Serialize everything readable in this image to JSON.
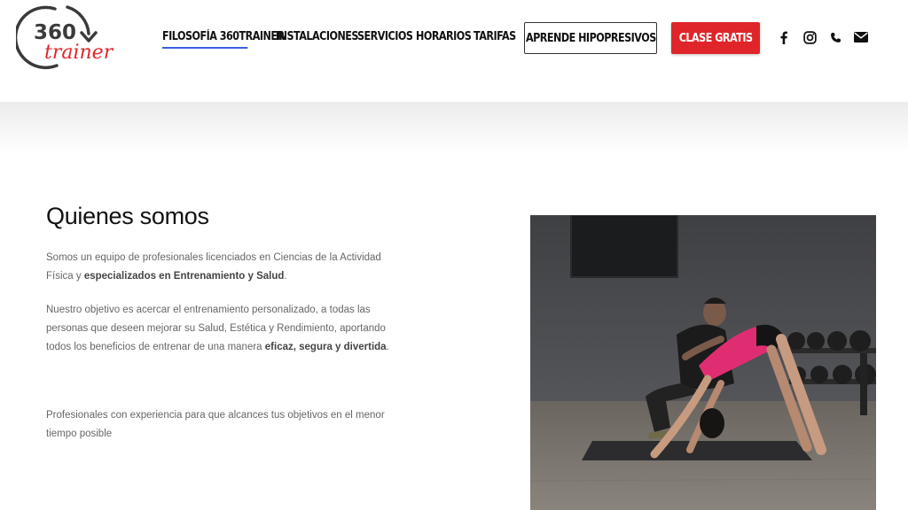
{
  "logo": {
    "number": "360",
    "word": "trainer",
    "alt": "360 trainer logo"
  },
  "nav": {
    "items": [
      {
        "label": "FILOSOFÍA 360TRAINER",
        "active": true
      },
      {
        "label": "INSTALACIONES",
        "active": false
      },
      {
        "label": "SERVICIOS",
        "active": false
      },
      {
        "label": "HORARIOS",
        "active": false
      },
      {
        "label": "TARIFAS",
        "active": false
      }
    ],
    "cta_outline": "APRENDE HIPOPRESIVOS",
    "cta_primary": "CLASE GRATIS",
    "social": [
      {
        "icon": "facebook-icon"
      },
      {
        "icon": "instagram-icon"
      },
      {
        "icon": "phone-icon"
      },
      {
        "icon": "mail-icon"
      }
    ]
  },
  "colors": {
    "accent_red": "#e0252a",
    "nav_underline": "#3d5fe0",
    "text_gray": "#666666"
  },
  "content": {
    "title": "Quienes somos",
    "p1": {
      "line1": "Somos un equipo de profesionales licenciados en Ciencias de la Actividad",
      "line2_pre": "Física y ",
      "line2_bold": "especializados en Entrenamiento y Salud",
      "line2_post": "."
    },
    "p2": {
      "line1": "Nuestro objetivo es acercar el entrenamiento personalizado, a todas las",
      "line2": "personas que deseen mejorar su Salud, Estética y Rendimiento, aportando",
      "line3_pre": "todos los beneficios de entrenar de una manera ",
      "line3_bold": "eficaz, segura y divertida",
      "line3_post": "."
    },
    "p3": {
      "line1": "Profesionales con experiencia para que alcances tus objetivos en el menor",
      "line2": "tiempo posible"
    },
    "photo_alt": "Trainer assisting a woman in a downward dog pose on a mat in the gym"
  }
}
